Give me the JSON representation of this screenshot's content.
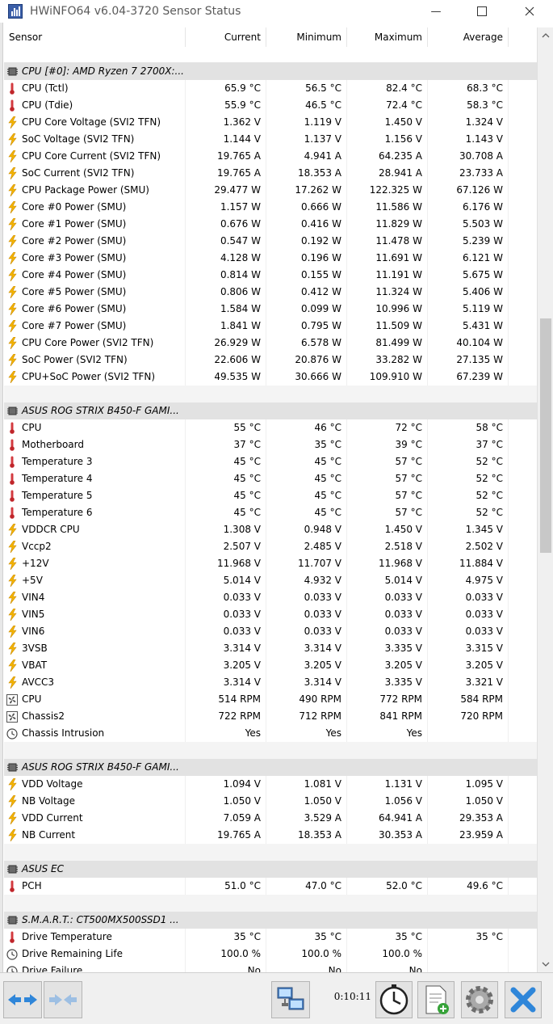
{
  "window": {
    "title": "HWiNFO64 v6.04-3720 Sensor Status"
  },
  "columns": [
    "Sensor",
    "Current",
    "Minimum",
    "Maximum",
    "Average"
  ],
  "rows": [
    {
      "type": "group",
      "label": "CPU [#0]: AMD Ryzen 7 2700X:..."
    },
    {
      "type": "sensor",
      "icon": "temperature",
      "label": "CPU (Tctl)",
      "current": "65.9 °C",
      "minimum": "56.5 °C",
      "maximum": "82.4 °C",
      "average": "68.3 °C"
    },
    {
      "type": "sensor",
      "icon": "temperature",
      "label": "CPU (Tdie)",
      "current": "55.9 °C",
      "minimum": "46.5 °C",
      "maximum": "72.4 °C",
      "average": "58.3 °C"
    },
    {
      "type": "sensor",
      "icon": "lightning",
      "label": "CPU Core Voltage (SVI2 TFN)",
      "current": "1.362 V",
      "minimum": "1.119 V",
      "maximum": "1.450 V",
      "average": "1.324 V"
    },
    {
      "type": "sensor",
      "icon": "lightning",
      "label": "SoC Voltage (SVI2 TFN)",
      "current": "1.144 V",
      "minimum": "1.137 V",
      "maximum": "1.156 V",
      "average": "1.143 V"
    },
    {
      "type": "sensor",
      "icon": "lightning",
      "label": "CPU Core Current (SVI2 TFN)",
      "current": "19.765 A",
      "minimum": "4.941 A",
      "maximum": "64.235 A",
      "average": "30.708 A"
    },
    {
      "type": "sensor",
      "icon": "lightning",
      "label": "SoC Current (SVI2 TFN)",
      "current": "19.765 A",
      "minimum": "18.353 A",
      "maximum": "28.941 A",
      "average": "23.733 A"
    },
    {
      "type": "sensor",
      "icon": "lightning",
      "label": "CPU Package Power (SMU)",
      "current": "29.477 W",
      "minimum": "17.262 W",
      "maximum": "122.325 W",
      "average": "67.126 W"
    },
    {
      "type": "sensor",
      "icon": "lightning",
      "label": "Core #0 Power (SMU)",
      "current": "1.157 W",
      "minimum": "0.666 W",
      "maximum": "11.586 W",
      "average": "6.176 W"
    },
    {
      "type": "sensor",
      "icon": "lightning",
      "label": "Core #1 Power (SMU)",
      "current": "0.676 W",
      "minimum": "0.416 W",
      "maximum": "11.829 W",
      "average": "5.503 W"
    },
    {
      "type": "sensor",
      "icon": "lightning",
      "label": "Core #2 Power (SMU)",
      "current": "0.547 W",
      "minimum": "0.192 W",
      "maximum": "11.478 W",
      "average": "5.239 W"
    },
    {
      "type": "sensor",
      "icon": "lightning",
      "label": "Core #3 Power (SMU)",
      "current": "4.128 W",
      "minimum": "0.196 W",
      "maximum": "11.691 W",
      "average": "6.121 W"
    },
    {
      "type": "sensor",
      "icon": "lightning",
      "label": "Core #4 Power (SMU)",
      "current": "0.814 W",
      "minimum": "0.155 W",
      "maximum": "11.191 W",
      "average": "5.675 W"
    },
    {
      "type": "sensor",
      "icon": "lightning",
      "label": "Core #5 Power (SMU)",
      "current": "0.806 W",
      "minimum": "0.412 W",
      "maximum": "11.324 W",
      "average": "5.406 W"
    },
    {
      "type": "sensor",
      "icon": "lightning",
      "label": "Core #6 Power (SMU)",
      "current": "1.584 W",
      "minimum": "0.099 W",
      "maximum": "10.996 W",
      "average": "5.119 W"
    },
    {
      "type": "sensor",
      "icon": "lightning",
      "label": "Core #7 Power (SMU)",
      "current": "1.841 W",
      "minimum": "0.795 W",
      "maximum": "11.509 W",
      "average": "5.431 W"
    },
    {
      "type": "sensor",
      "icon": "lightning",
      "label": "CPU Core Power (SVI2 TFN)",
      "current": "26.929 W",
      "minimum": "6.578 W",
      "maximum": "81.499 W",
      "average": "40.104 W"
    },
    {
      "type": "sensor",
      "icon": "lightning",
      "label": "SoC Power (SVI2 TFN)",
      "current": "22.606 W",
      "minimum": "20.876 W",
      "maximum": "33.282 W",
      "average": "27.135 W"
    },
    {
      "type": "sensor",
      "icon": "lightning",
      "label": "CPU+SoC Power (SVI2 TFN)",
      "current": "49.535 W",
      "minimum": "30.666 W",
      "maximum": "109.910 W",
      "average": "67.239 W"
    },
    {
      "type": "blank"
    },
    {
      "type": "group",
      "label": "ASUS ROG STRIX B450-F GAMI..."
    },
    {
      "type": "sensor",
      "icon": "temperature",
      "label": "CPU",
      "current": "55 °C",
      "minimum": "46 °C",
      "maximum": "72 °C",
      "average": "58 °C"
    },
    {
      "type": "sensor",
      "icon": "temperature",
      "label": "Motherboard",
      "current": "37 °C",
      "minimum": "35 °C",
      "maximum": "39 °C",
      "average": "37 °C"
    },
    {
      "type": "sensor",
      "icon": "temperature",
      "label": "Temperature 3",
      "current": "45 °C",
      "minimum": "45 °C",
      "maximum": "57 °C",
      "average": "52 °C"
    },
    {
      "type": "sensor",
      "icon": "temperature",
      "label": "Temperature 4",
      "current": "45 °C",
      "minimum": "45 °C",
      "maximum": "57 °C",
      "average": "52 °C"
    },
    {
      "type": "sensor",
      "icon": "temperature",
      "label": "Temperature 5",
      "current": "45 °C",
      "minimum": "45 °C",
      "maximum": "57 °C",
      "average": "52 °C"
    },
    {
      "type": "sensor",
      "icon": "temperature",
      "label": "Temperature 6",
      "current": "45 °C",
      "minimum": "45 °C",
      "maximum": "57 °C",
      "average": "52 °C"
    },
    {
      "type": "sensor",
      "icon": "lightning",
      "label": "VDDCR CPU",
      "current": "1.308 V",
      "minimum": "0.948 V",
      "maximum": "1.450 V",
      "average": "1.345 V"
    },
    {
      "type": "sensor",
      "icon": "lightning",
      "label": "Vccp2",
      "current": "2.507 V",
      "minimum": "2.485 V",
      "maximum": "2.518 V",
      "average": "2.502 V"
    },
    {
      "type": "sensor",
      "icon": "lightning",
      "label": "+12V",
      "current": "11.968 V",
      "minimum": "11.707 V",
      "maximum": "11.968 V",
      "average": "11.884 V"
    },
    {
      "type": "sensor",
      "icon": "lightning",
      "label": "+5V",
      "current": "5.014 V",
      "minimum": "4.932 V",
      "maximum": "5.014 V",
      "average": "4.975 V"
    },
    {
      "type": "sensor",
      "icon": "lightning",
      "label": "VIN4",
      "current": "0.033 V",
      "minimum": "0.033 V",
      "maximum": "0.033 V",
      "average": "0.033 V"
    },
    {
      "type": "sensor",
      "icon": "lightning",
      "label": "VIN5",
      "current": "0.033 V",
      "minimum": "0.033 V",
      "maximum": "0.033 V",
      "average": "0.033 V"
    },
    {
      "type": "sensor",
      "icon": "lightning",
      "label": "VIN6",
      "current": "0.033 V",
      "minimum": "0.033 V",
      "maximum": "0.033 V",
      "average": "0.033 V"
    },
    {
      "type": "sensor",
      "icon": "lightning",
      "label": "3VSB",
      "current": "3.314 V",
      "minimum": "3.314 V",
      "maximum": "3.335 V",
      "average": "3.315 V"
    },
    {
      "type": "sensor",
      "icon": "lightning",
      "label": "VBAT",
      "current": "3.205 V",
      "minimum": "3.205 V",
      "maximum": "3.205 V",
      "average": "3.205 V"
    },
    {
      "type": "sensor",
      "icon": "lightning",
      "label": "AVCC3",
      "current": "3.314 V",
      "minimum": "3.314 V",
      "maximum": "3.335 V",
      "average": "3.321 V"
    },
    {
      "type": "sensor",
      "icon": "fan",
      "label": "CPU",
      "current": "514 RPM",
      "minimum": "490 RPM",
      "maximum": "772 RPM",
      "average": "584 RPM"
    },
    {
      "type": "sensor",
      "icon": "fan",
      "label": "Chassis2",
      "current": "722 RPM",
      "minimum": "712 RPM",
      "maximum": "841 RPM",
      "average": "720 RPM"
    },
    {
      "type": "sensor",
      "icon": "clock",
      "label": "Chassis Intrusion",
      "current": "Yes",
      "minimum": "Yes",
      "maximum": "Yes",
      "average": ""
    },
    {
      "type": "blank"
    },
    {
      "type": "group",
      "label": "ASUS ROG STRIX B450-F GAMI..."
    },
    {
      "type": "sensor",
      "icon": "lightning",
      "label": "VDD Voltage",
      "current": "1.094 V",
      "minimum": "1.081 V",
      "maximum": "1.131 V",
      "average": "1.095 V"
    },
    {
      "type": "sensor",
      "icon": "lightning",
      "label": "NB Voltage",
      "current": "1.050 V",
      "minimum": "1.050 V",
      "maximum": "1.056 V",
      "average": "1.050 V"
    },
    {
      "type": "sensor",
      "icon": "lightning",
      "label": "VDD Current",
      "current": "7.059 A",
      "minimum": "3.529 A",
      "maximum": "64.941 A",
      "average": "29.353 A"
    },
    {
      "type": "sensor",
      "icon": "lightning",
      "label": "NB Current",
      "current": "19.765 A",
      "minimum": "18.353 A",
      "maximum": "30.353 A",
      "average": "23.959 A"
    },
    {
      "type": "blank"
    },
    {
      "type": "group",
      "label": "ASUS EC"
    },
    {
      "type": "sensor",
      "icon": "temperature",
      "label": "PCH",
      "current": "51.0 °C",
      "minimum": "47.0 °C",
      "maximum": "52.0 °C",
      "average": "49.6 °C"
    },
    {
      "type": "blank"
    },
    {
      "type": "group",
      "label": "S.M.A.R.T.: CT500MX500SSD1 ..."
    },
    {
      "type": "sensor",
      "icon": "temperature",
      "label": "Drive Temperature",
      "current": "35 °C",
      "minimum": "35 °C",
      "maximum": "35 °C",
      "average": "35 °C"
    },
    {
      "type": "sensor",
      "icon": "clock",
      "label": "Drive Remaining Life",
      "current": "100.0 %",
      "minimum": "100.0 %",
      "maximum": "100.0 %",
      "average": ""
    },
    {
      "type": "sensor",
      "icon": "clock",
      "label": "Drive Failure",
      "current": "No",
      "minimum": "No",
      "maximum": "No",
      "average": ""
    }
  ],
  "toolbar": {
    "elapsed": "0:10:11"
  },
  "icons": {
    "app": "hwinfo-icon",
    "minimize": "minimize-icon",
    "maximize": "maximize-icon",
    "close": "close-icon",
    "nav_expand": "arrows-expand-icon",
    "nav_collapse": "arrows-collapse-icon",
    "network": "network-icon",
    "stopwatch": "stopwatch-icon",
    "report": "report-add-icon",
    "settings": "gear-icon",
    "exit": "exit-icon"
  },
  "colors": {
    "group_bg": "#e2e2e2",
    "temperature": "#c0262b",
    "lightning": "#f4b400",
    "accent_blue": "#2f86d9"
  }
}
